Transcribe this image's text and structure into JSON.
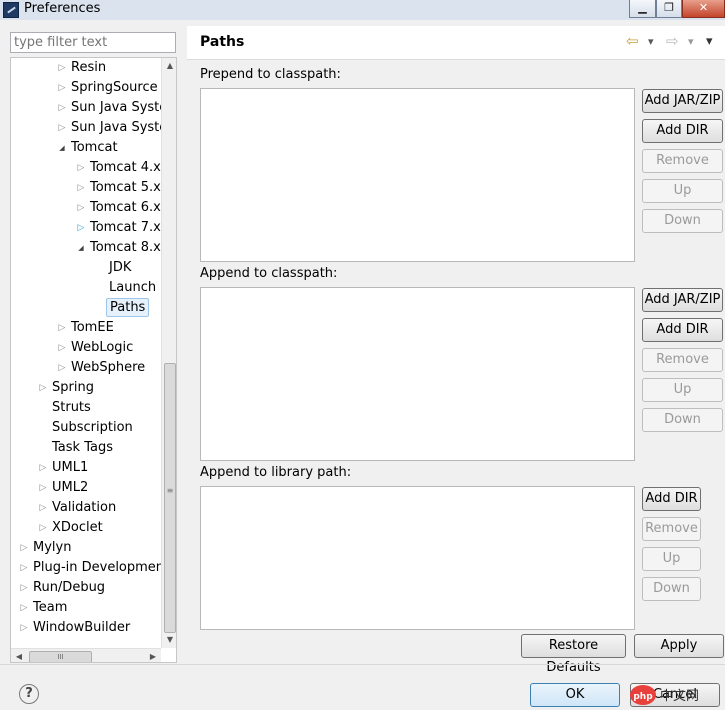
{
  "window": {
    "title": "Preferences",
    "min_glyph": "▁",
    "max_glyph": "❐",
    "close_glyph": "✕"
  },
  "filter": {
    "placeholder": "type filter text"
  },
  "tree": [
    {
      "label": "Resin",
      "twisty": "▷",
      "indent": 2
    },
    {
      "label": "SpringSource",
      "twisty": "▷",
      "indent": 2
    },
    {
      "label": "Sun Java Syster",
      "twisty": "▷",
      "indent": 2
    },
    {
      "label": "Sun Java Syster",
      "twisty": "▷",
      "indent": 2
    },
    {
      "label": "Tomcat",
      "twisty": "◢",
      "indent": 2
    },
    {
      "label": "Tomcat  4.x",
      "twisty": "▷",
      "indent": 3
    },
    {
      "label": "Tomcat  5.x",
      "twisty": "▷",
      "indent": 3
    },
    {
      "label": "Tomcat  6.x",
      "twisty": "▷",
      "indent": 3
    },
    {
      "label": "Tomcat  7.x",
      "twisty": "▷",
      "indent": 3,
      "highlight_twisty": true
    },
    {
      "label": "Tomcat  8.x",
      "twisty": "◢",
      "indent": 3
    },
    {
      "label": "JDK",
      "twisty": "",
      "indent": 4
    },
    {
      "label": "Launch",
      "twisty": "",
      "indent": 4
    },
    {
      "label": "Paths",
      "twisty": "",
      "indent": 4,
      "selected": true
    },
    {
      "label": "TomEE",
      "twisty": "▷",
      "indent": 2
    },
    {
      "label": "WebLogic",
      "twisty": "▷",
      "indent": 2
    },
    {
      "label": "WebSphere",
      "twisty": "▷",
      "indent": 2
    },
    {
      "label": "Spring",
      "twisty": "▷",
      "indent": 1
    },
    {
      "label": "Struts",
      "twisty": "",
      "indent": 1
    },
    {
      "label": "Subscription",
      "twisty": "",
      "indent": 1
    },
    {
      "label": "Task Tags",
      "twisty": "",
      "indent": 1
    },
    {
      "label": "UML1",
      "twisty": "▷",
      "indent": 1
    },
    {
      "label": "UML2",
      "twisty": "▷",
      "indent": 1
    },
    {
      "label": "Validation",
      "twisty": "▷",
      "indent": 1
    },
    {
      "label": "XDoclet",
      "twisty": "▷",
      "indent": 1
    },
    {
      "label": "Mylyn",
      "twisty": "▷",
      "indent": 0
    },
    {
      "label": "Plug-in Development",
      "twisty": "▷",
      "indent": 0
    },
    {
      "label": "Run/Debug",
      "twisty": "▷",
      "indent": 0
    },
    {
      "label": "Team",
      "twisty": "▷",
      "indent": 0
    },
    {
      "label": "WindowBuilder",
      "twisty": "▷",
      "indent": 0
    }
  ],
  "scroll": {
    "up": "▲",
    "down": "▼",
    "left": "◀",
    "right": "▶",
    "grip": "≡",
    "hgrip": "III"
  },
  "page": {
    "title": "Paths",
    "back_glyph": "⇦",
    "fwd_glyph": "⇨",
    "menu_glyph": "▾"
  },
  "sections": {
    "prepend": {
      "label": "Prepend to classpath:"
    },
    "append": {
      "label": "Append to classpath:"
    },
    "library": {
      "label": "Append to library path:"
    }
  },
  "buttons": {
    "add_jar": "Add JAR/ZIP",
    "add_dir": "Add DIR",
    "remove": "Remove",
    "up": "Up",
    "down": "Down",
    "restore_defaults": "Restore Defaults",
    "apply": "Apply",
    "ok": "OK",
    "cancel": "Cancel",
    "help": "?"
  },
  "watermark": {
    "text": "php中文网"
  },
  "colors": {
    "accent": "#3c7fb1",
    "selection": "#e5f1fb"
  }
}
